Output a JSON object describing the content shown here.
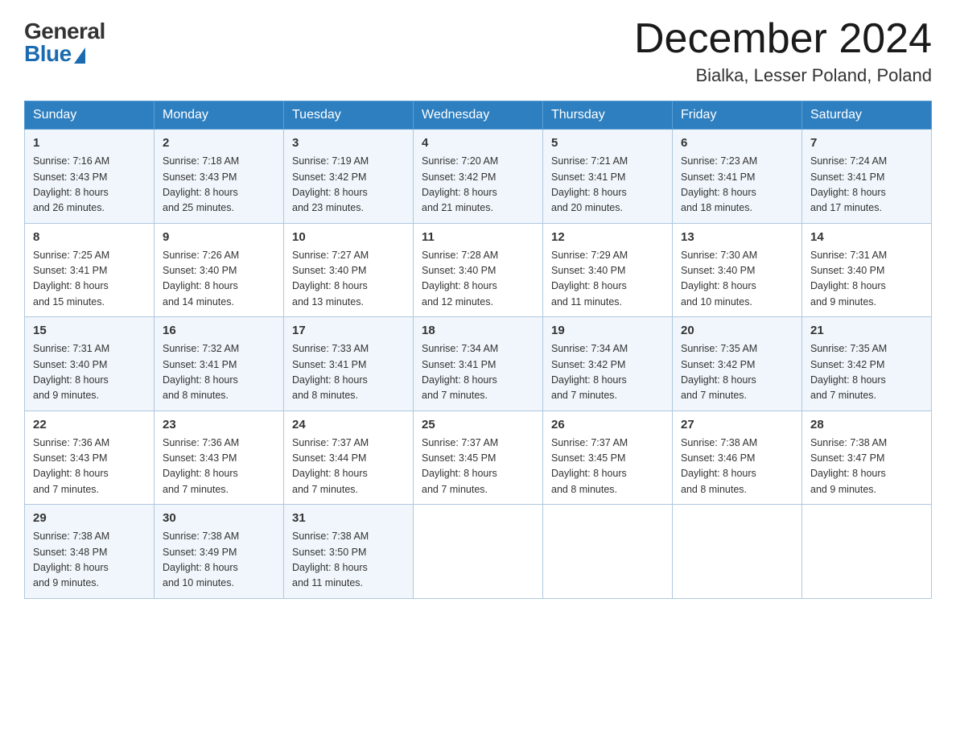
{
  "logo": {
    "general": "General",
    "blue": "Blue"
  },
  "header": {
    "month": "December 2024",
    "location": "Bialka, Lesser Poland, Poland"
  },
  "weekdays": [
    "Sunday",
    "Monday",
    "Tuesday",
    "Wednesday",
    "Thursday",
    "Friday",
    "Saturday"
  ],
  "weeks": [
    [
      {
        "day": "1",
        "sunrise": "7:16 AM",
        "sunset": "3:43 PM",
        "daylight": "8 hours and 26 minutes."
      },
      {
        "day": "2",
        "sunrise": "7:18 AM",
        "sunset": "3:43 PM",
        "daylight": "8 hours and 25 minutes."
      },
      {
        "day": "3",
        "sunrise": "7:19 AM",
        "sunset": "3:42 PM",
        "daylight": "8 hours and 23 minutes."
      },
      {
        "day": "4",
        "sunrise": "7:20 AM",
        "sunset": "3:42 PM",
        "daylight": "8 hours and 21 minutes."
      },
      {
        "day": "5",
        "sunrise": "7:21 AM",
        "sunset": "3:41 PM",
        "daylight": "8 hours and 20 minutes."
      },
      {
        "day": "6",
        "sunrise": "7:23 AM",
        "sunset": "3:41 PM",
        "daylight": "8 hours and 18 minutes."
      },
      {
        "day": "7",
        "sunrise": "7:24 AM",
        "sunset": "3:41 PM",
        "daylight": "8 hours and 17 minutes."
      }
    ],
    [
      {
        "day": "8",
        "sunrise": "7:25 AM",
        "sunset": "3:41 PM",
        "daylight": "8 hours and 15 minutes."
      },
      {
        "day": "9",
        "sunrise": "7:26 AM",
        "sunset": "3:40 PM",
        "daylight": "8 hours and 14 minutes."
      },
      {
        "day": "10",
        "sunrise": "7:27 AM",
        "sunset": "3:40 PM",
        "daylight": "8 hours and 13 minutes."
      },
      {
        "day": "11",
        "sunrise": "7:28 AM",
        "sunset": "3:40 PM",
        "daylight": "8 hours and 12 minutes."
      },
      {
        "day": "12",
        "sunrise": "7:29 AM",
        "sunset": "3:40 PM",
        "daylight": "8 hours and 11 minutes."
      },
      {
        "day": "13",
        "sunrise": "7:30 AM",
        "sunset": "3:40 PM",
        "daylight": "8 hours and 10 minutes."
      },
      {
        "day": "14",
        "sunrise": "7:31 AM",
        "sunset": "3:40 PM",
        "daylight": "8 hours and 9 minutes."
      }
    ],
    [
      {
        "day": "15",
        "sunrise": "7:31 AM",
        "sunset": "3:40 PM",
        "daylight": "8 hours and 9 minutes."
      },
      {
        "day": "16",
        "sunrise": "7:32 AM",
        "sunset": "3:41 PM",
        "daylight": "8 hours and 8 minutes."
      },
      {
        "day": "17",
        "sunrise": "7:33 AM",
        "sunset": "3:41 PM",
        "daylight": "8 hours and 8 minutes."
      },
      {
        "day": "18",
        "sunrise": "7:34 AM",
        "sunset": "3:41 PM",
        "daylight": "8 hours and 7 minutes."
      },
      {
        "day": "19",
        "sunrise": "7:34 AM",
        "sunset": "3:42 PM",
        "daylight": "8 hours and 7 minutes."
      },
      {
        "day": "20",
        "sunrise": "7:35 AM",
        "sunset": "3:42 PM",
        "daylight": "8 hours and 7 minutes."
      },
      {
        "day": "21",
        "sunrise": "7:35 AM",
        "sunset": "3:42 PM",
        "daylight": "8 hours and 7 minutes."
      }
    ],
    [
      {
        "day": "22",
        "sunrise": "7:36 AM",
        "sunset": "3:43 PM",
        "daylight": "8 hours and 7 minutes."
      },
      {
        "day": "23",
        "sunrise": "7:36 AM",
        "sunset": "3:43 PM",
        "daylight": "8 hours and 7 minutes."
      },
      {
        "day": "24",
        "sunrise": "7:37 AM",
        "sunset": "3:44 PM",
        "daylight": "8 hours and 7 minutes."
      },
      {
        "day": "25",
        "sunrise": "7:37 AM",
        "sunset": "3:45 PM",
        "daylight": "8 hours and 7 minutes."
      },
      {
        "day": "26",
        "sunrise": "7:37 AM",
        "sunset": "3:45 PM",
        "daylight": "8 hours and 8 minutes."
      },
      {
        "day": "27",
        "sunrise": "7:38 AM",
        "sunset": "3:46 PM",
        "daylight": "8 hours and 8 minutes."
      },
      {
        "day": "28",
        "sunrise": "7:38 AM",
        "sunset": "3:47 PM",
        "daylight": "8 hours and 9 minutes."
      }
    ],
    [
      {
        "day": "29",
        "sunrise": "7:38 AM",
        "sunset": "3:48 PM",
        "daylight": "8 hours and 9 minutes."
      },
      {
        "day": "30",
        "sunrise": "7:38 AM",
        "sunset": "3:49 PM",
        "daylight": "8 hours and 10 minutes."
      },
      {
        "day": "31",
        "sunrise": "7:38 AM",
        "sunset": "3:50 PM",
        "daylight": "8 hours and 11 minutes."
      },
      null,
      null,
      null,
      null
    ]
  ],
  "labels": {
    "sunrise": "Sunrise:",
    "sunset": "Sunset:",
    "daylight": "Daylight:"
  }
}
